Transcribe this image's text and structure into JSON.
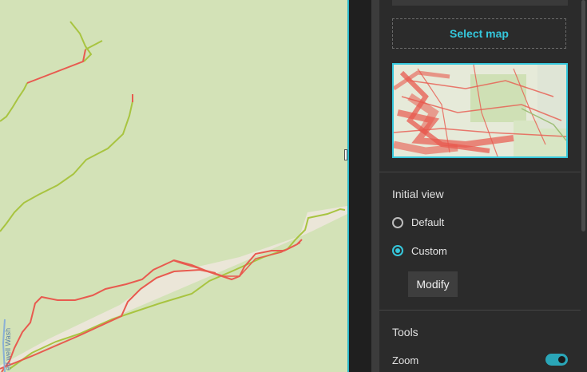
{
  "map": {
    "street_label": "ed well Wash"
  },
  "settings": {
    "select_map_label": "Select map",
    "initial_view": {
      "title": "Initial view",
      "options": [
        {
          "label": "Default",
          "selected": false
        },
        {
          "label": "Custom",
          "selected": true
        }
      ],
      "modify_label": "Modify"
    },
    "tools": {
      "title": "Tools",
      "zoom_label": "Zoom",
      "zoom_enabled": true
    }
  },
  "colors": {
    "accent": "#35c7dc",
    "map_background": "#d3e2b7",
    "route_red": "#e85a4f",
    "route_green": "#a8c440"
  }
}
